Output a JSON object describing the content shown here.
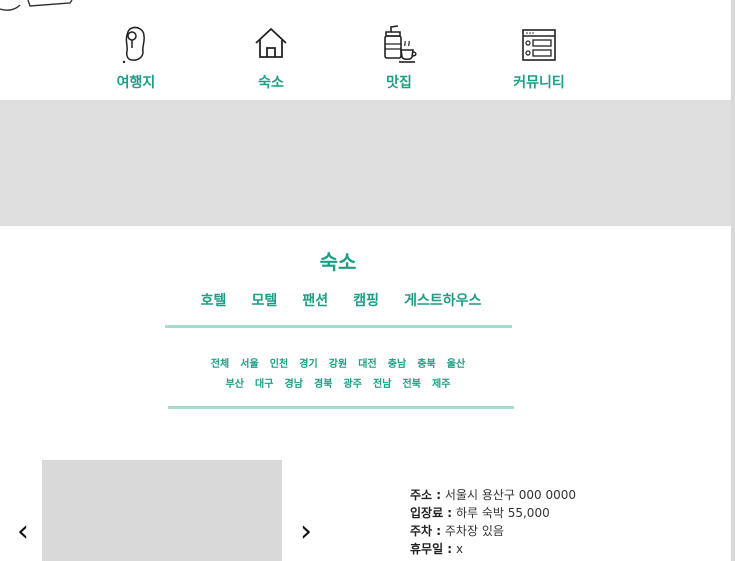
{
  "nav": {
    "items": [
      {
        "label": "여행지",
        "icon": "korea-map-pin-icon"
      },
      {
        "label": "숙소",
        "icon": "house-icon"
      },
      {
        "label": "맛집",
        "icon": "coffee-cup-icon"
      },
      {
        "label": "커뮤니티",
        "icon": "board-list-icon"
      }
    ]
  },
  "section": {
    "title": "숙소",
    "categories": [
      "호텔",
      "모텔",
      "팬션",
      "캠핑",
      "게스트하우스"
    ],
    "regions_row1": [
      "전체",
      "서울",
      "인천",
      "경기",
      "강원",
      "대전",
      "충남",
      "충북",
      "울산"
    ],
    "regions_row2": [
      "부산",
      "대구",
      "경남",
      "경북",
      "광주",
      "전남",
      "전북",
      "제주"
    ]
  },
  "carousel": {
    "prev_symbol": "‹",
    "next_symbol": "›"
  },
  "info": {
    "address_label": "주소 :",
    "address_value": "서울시 용산구 000  0000",
    "fee_label": "입장료 :",
    "fee_value": "하루 숙박 55,000",
    "parking_label": "주차 :",
    "parking_value": "주차장 있음",
    "closed_label": "휴무일 :",
    "closed_value": "x"
  },
  "colors": {
    "accent": "#1e9e85",
    "divider": "#a6dccf",
    "placeholder": "#dedede"
  }
}
